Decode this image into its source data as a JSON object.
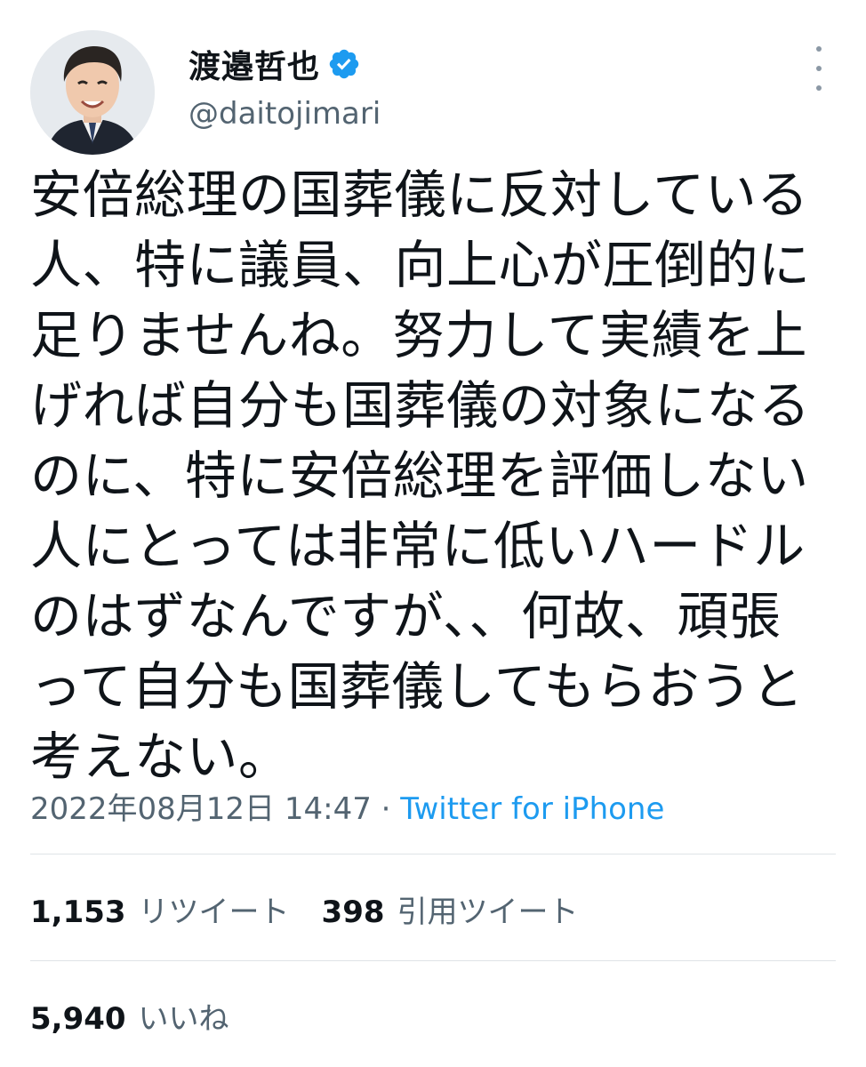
{
  "author": {
    "display_name": "渡邉哲也",
    "handle": "@daitojimari",
    "verified_icon": "verified-badge-icon",
    "avatar": "profile-photo"
  },
  "tweet": {
    "lines": [
      "安倍総理の国葬儀に反対している",
      "人、特に議員、向上心が圧倒的に",
      "足りませんね。努力して実績を上",
      "げれば自分も国葬儀の対象になる",
      "のに、特に安倍総理を評価しない",
      "人にとっては非常に低いハードル",
      "のはずなんですが、、何故、頑張",
      "って自分も国葬儀してもらおうと",
      "考えない。"
    ],
    "timestamp": "2022年08月12日 14:47",
    "separator": " · ",
    "source": "Twitter for iPhone"
  },
  "stats": {
    "retweets_count": "1,153",
    "retweets_label": "リツイート",
    "quotes_count": "398",
    "quotes_label": "引用ツイート",
    "likes_count": "5,940",
    "likes_label": "いいね"
  },
  "colors": {
    "link": "#1d9bf0",
    "secondary_text": "#536471",
    "verified": "#1d9bf0"
  }
}
